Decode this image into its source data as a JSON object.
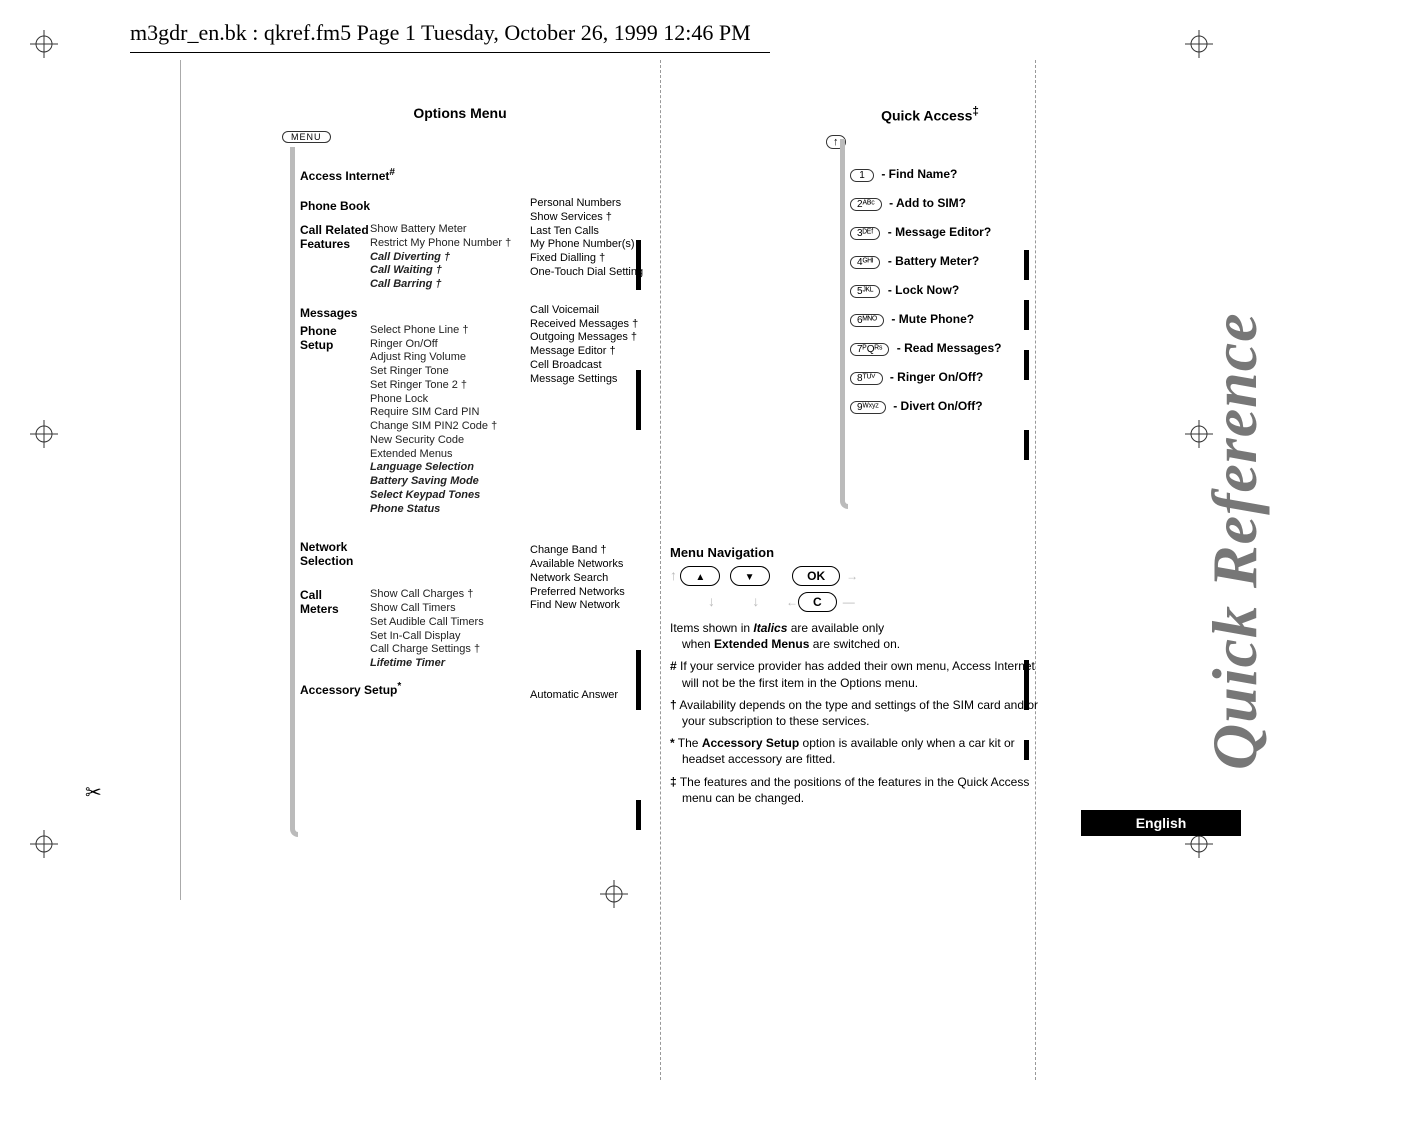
{
  "header": {
    "running_head": "m3gdr_en.bk : qkref.fm5  Page 1  Tuesday, October 26, 1999  12:46 PM"
  },
  "options_menu": {
    "title": "Options Menu",
    "root_key": "MENU",
    "access_internet": "Access Internet",
    "access_internet_note": "#",
    "phone_book": {
      "label": "Phone Book",
      "items": [
        "Personal Numbers",
        "Show Services †",
        "Last Ten Calls",
        "My Phone Number(s)",
        "Fixed Dialling †",
        "One-Touch Dial Setting"
      ]
    },
    "call_related": {
      "label": "Call Related Features",
      "items": [
        "Show Battery Meter",
        "Restrict My Phone Number †",
        "Call Diverting †",
        "Call Waiting †",
        "Call Barring †"
      ]
    },
    "messages": {
      "label": "Messages",
      "items": [
        "Call Voicemail",
        "Received Messages †",
        "Outgoing Messages †",
        "Message Editor †",
        "Cell Broadcast",
        "Message Settings"
      ]
    },
    "phone_setup": {
      "label": "Phone Setup",
      "items": [
        "Select Phone Line †",
        "Ringer On/Off",
        "Adjust Ring Volume",
        "Set Ringer Tone",
        "Set Ringer Tone 2 †",
        "Phone Lock",
        "Require SIM Card PIN",
        "Change SIM PIN2 Code †",
        "New Security Code",
        "Extended Menus",
        "Language Selection",
        "Battery Saving Mode",
        "Select Keypad Tones",
        "Phone Status"
      ]
    },
    "network_selection": {
      "label": "Network Selection",
      "items": [
        "Change Band †",
        "Available Networks",
        "Network Search",
        "Preferred Networks",
        "Find New Network"
      ]
    },
    "call_meters": {
      "label": "Call Meters",
      "items": [
        "Show Call Charges †",
        "Show Call Timers",
        "Set Audible Call Timers",
        "Set In-Call Display",
        "Call Charge Settings †",
        "Lifetime Timer"
      ]
    },
    "accessory_setup": {
      "label": "Accessory Setup",
      "note": "*",
      "items": [
        "Automatic Answer"
      ]
    }
  },
  "quick_access": {
    "title": "Quick Access",
    "title_note": "‡",
    "root_key": "↑",
    "items": [
      {
        "key": "1",
        "label": "Find Name?"
      },
      {
        "key": "2ᴬᴮᶜ",
        "label": "Add to SIM?"
      },
      {
        "key": "3ᴰᴱᶠ",
        "label": "Message Editor?"
      },
      {
        "key": "4ᴳᴴᴵ",
        "label": "Battery Meter?"
      },
      {
        "key": "5ᴶᴷᴸ",
        "label": "Lock Now?"
      },
      {
        "key": "6ᴹᴺᴼ",
        "label": "Mute Phone?"
      },
      {
        "key": "7ᴾQᴿˢ",
        "label": "Read Messages?"
      },
      {
        "key": "8ᵀᵁⱽ",
        "label": "Ringer On/Off?"
      },
      {
        "key": "9ᵂˣʸᶻ",
        "label": "Divert On/Off?"
      }
    ]
  },
  "menu_nav": {
    "title": "Menu Navigation",
    "ok_key": "OK",
    "c_key": "C",
    "note_italics": "Items shown in Italics are available only when Extended Menus are switched on.",
    "note_hash": "If your service provider has added their own menu, Access Internet will not be the first item in the Options menu.",
    "note_dagger": "Availability depends on the type and settings of the SIM card and/or your subscription to these services.",
    "note_star": "The Accessory Setup option is available only when a car kit or headset accessory are fitted.",
    "note_ddagger": "The features and the positions of the features in the Quick Access menu can be changed."
  },
  "spine": {
    "title": "Quick Reference",
    "language": "English"
  }
}
